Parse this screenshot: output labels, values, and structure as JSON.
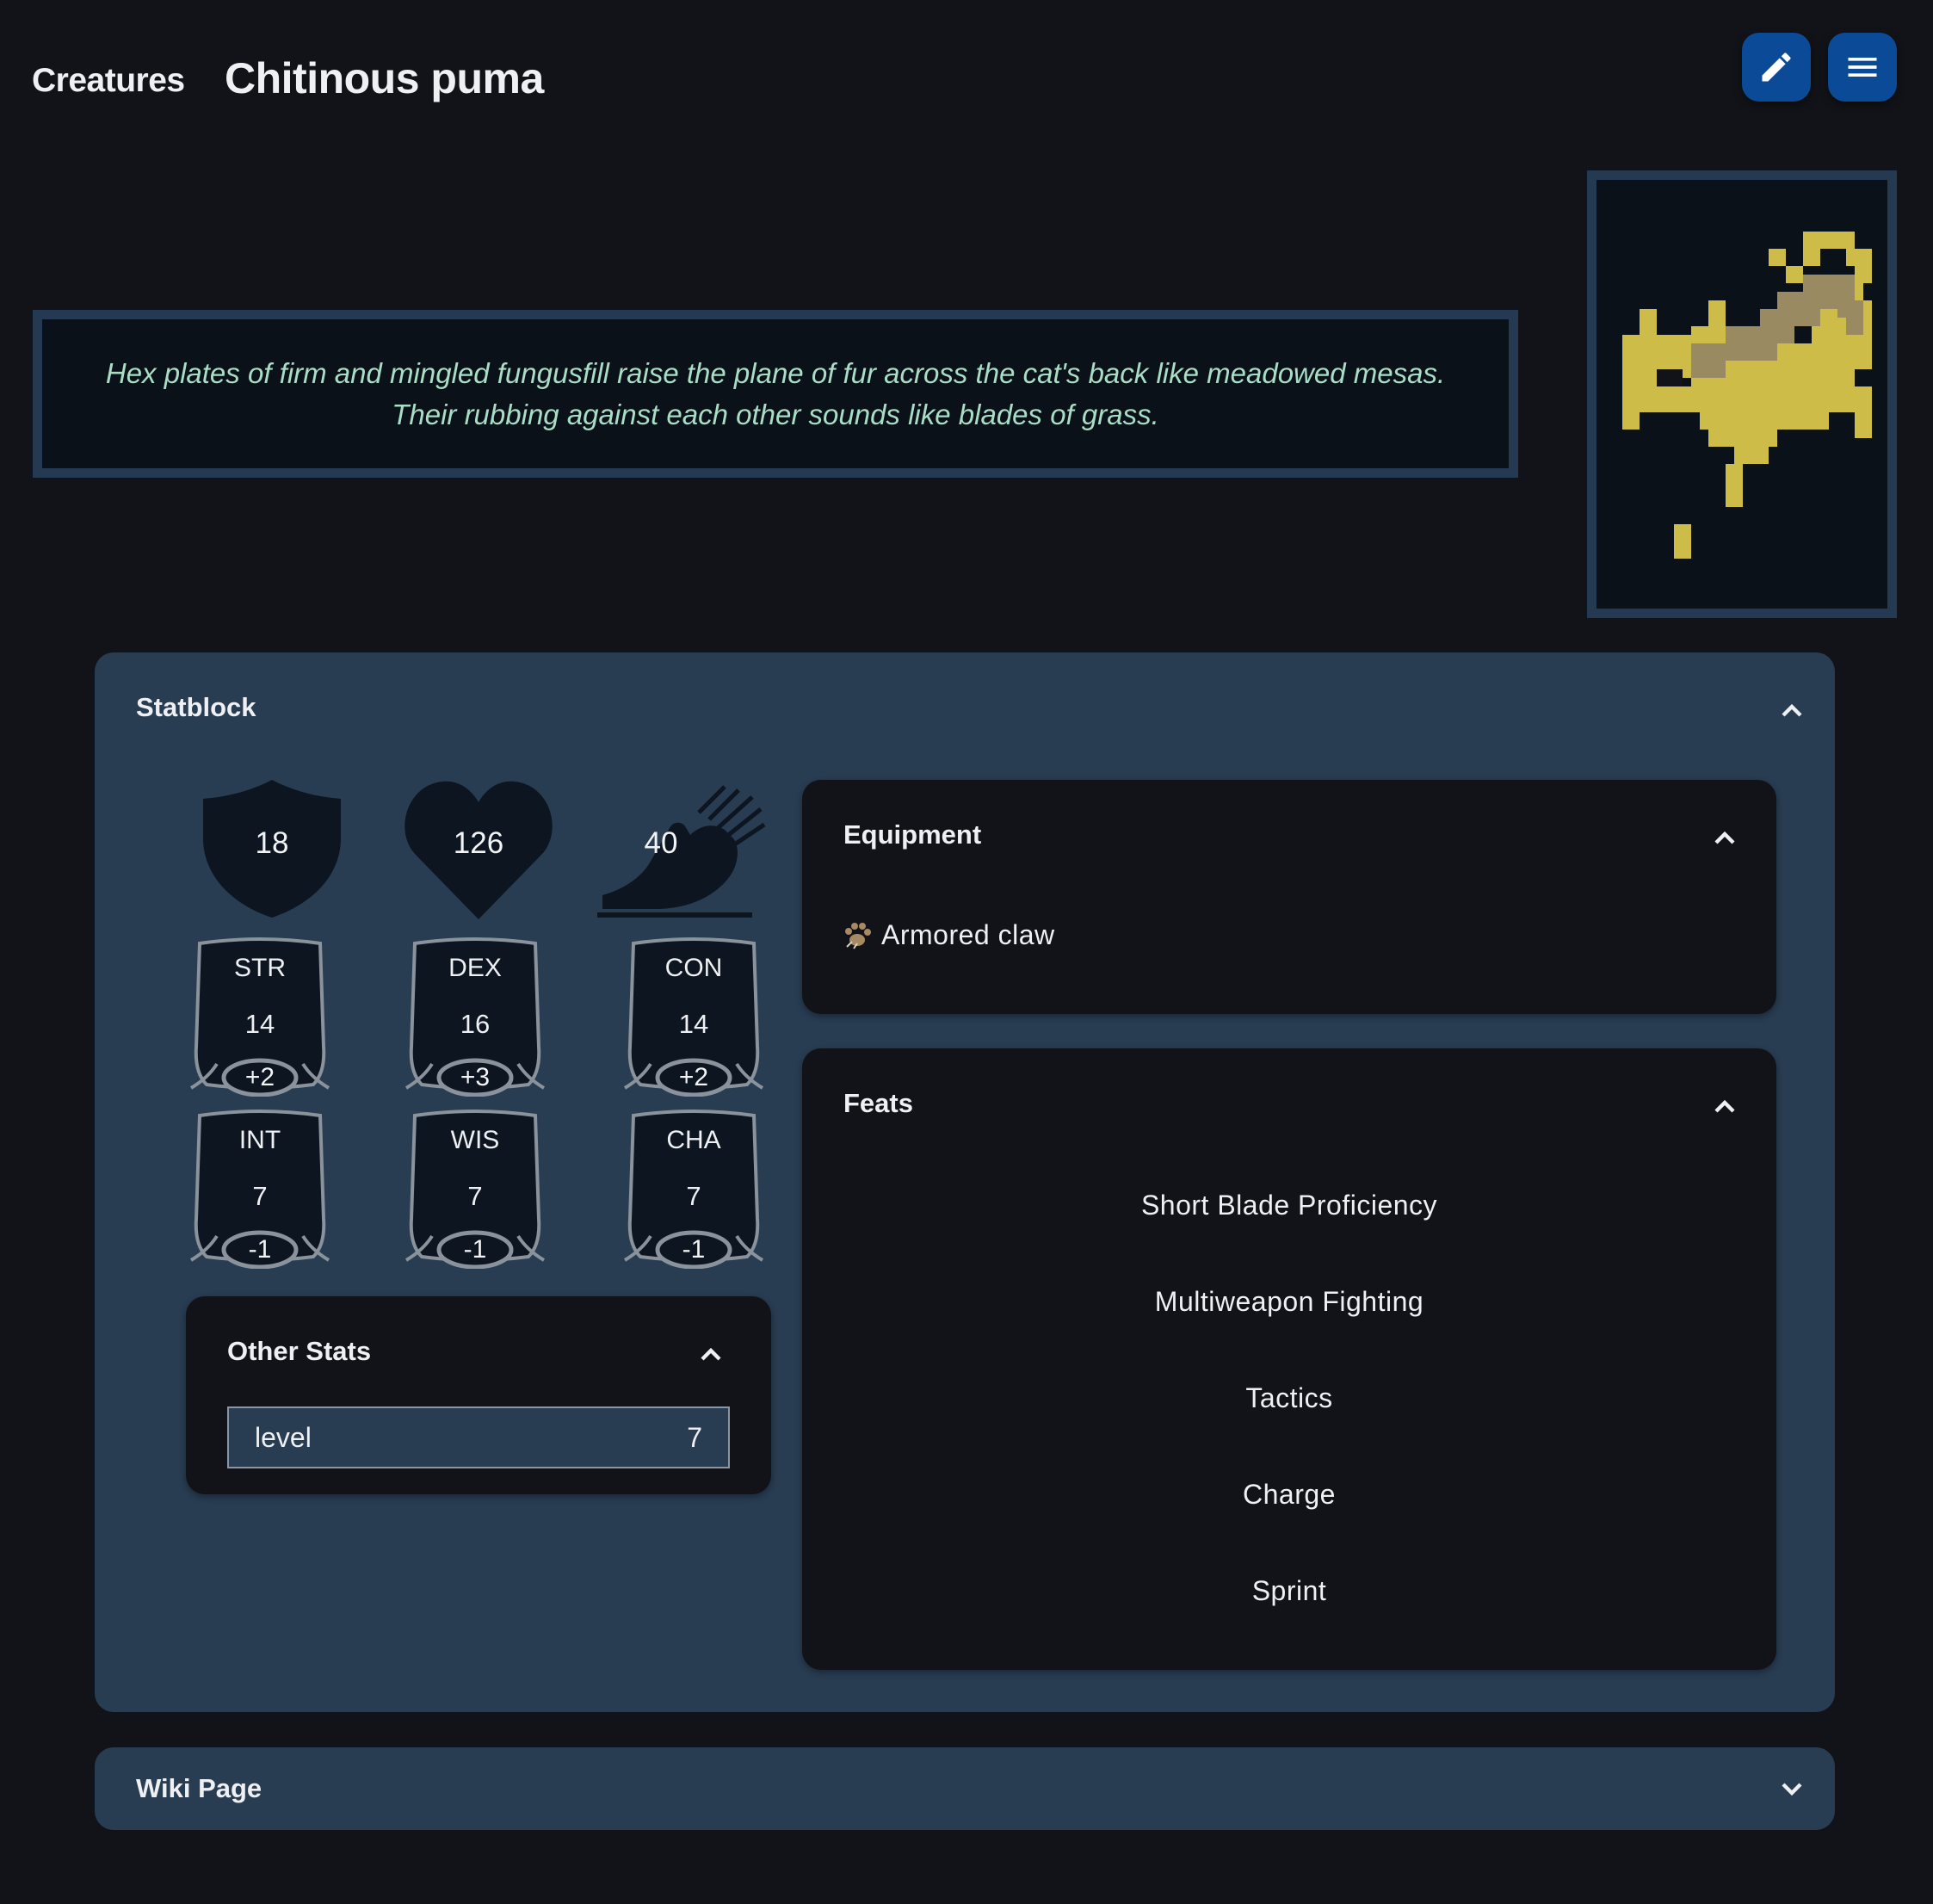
{
  "header": {
    "breadcrumb": "Creatures",
    "title": "Chitinous puma",
    "edit_icon": "pencil-icon",
    "menu_icon": "hamburger-menu-icon"
  },
  "description": "Hex plates of firm and mingled fungusfill raise the plane of fur across the cat's back like meadowed mesas. Their rubbing against each other sounds like blades of grass.",
  "portrait": {
    "icon": "creature-pixel-art",
    "colors": {
      "body": "#cdbd48",
      "back": "#998a62"
    }
  },
  "statblock": {
    "title": "Statblock",
    "armor_class": "18",
    "hit_points": "126",
    "speed": "40",
    "abilities": [
      {
        "abbr": "STR",
        "score": "14",
        "mod": "+2"
      },
      {
        "abbr": "DEX",
        "score": "16",
        "mod": "+3"
      },
      {
        "abbr": "CON",
        "score": "14",
        "mod": "+2"
      },
      {
        "abbr": "INT",
        "score": "7",
        "mod": "-1"
      },
      {
        "abbr": "WIS",
        "score": "7",
        "mod": "-1"
      },
      {
        "abbr": "CHA",
        "score": "7",
        "mod": "-1"
      }
    ],
    "other_stats": {
      "title": "Other Stats",
      "rows": [
        {
          "name": "level",
          "value": "7"
        }
      ]
    },
    "equipment": {
      "title": "Equipment",
      "items": [
        {
          "name": "Armored claw",
          "icon": "claw-icon"
        }
      ]
    },
    "feats": {
      "title": "Feats",
      "items": [
        "Short Blade Proficiency",
        "Multiweapon Fighting",
        "Tactics",
        "Charge",
        "Sprint"
      ]
    }
  },
  "wiki": {
    "title": "Wiki Page"
  },
  "colors": {
    "accent": "#0a4a96",
    "panel": "#283c52",
    "card": "#111318",
    "description_text": "#a9ddc6"
  }
}
